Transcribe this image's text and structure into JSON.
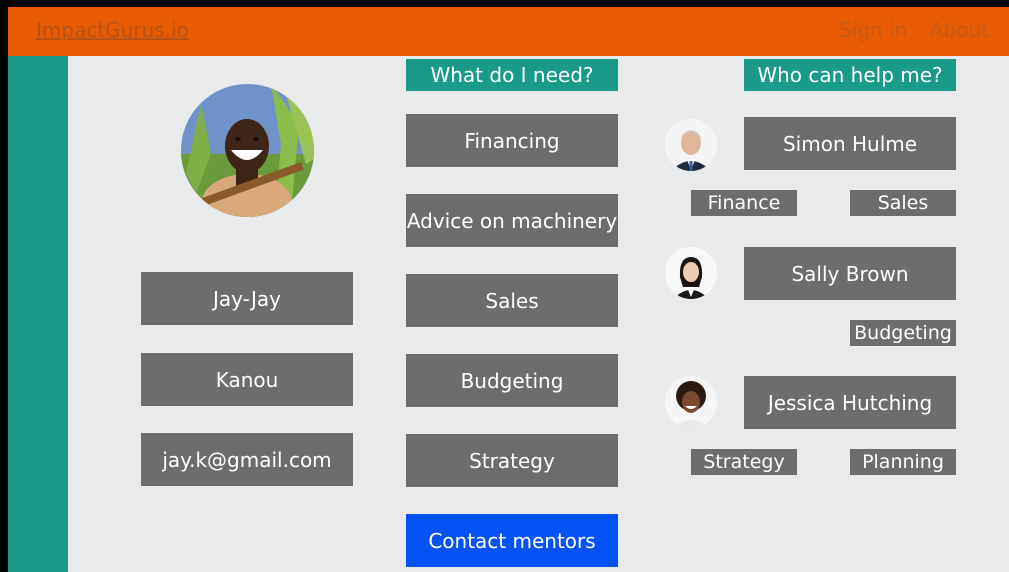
{
  "header": {
    "brand": "ImpactGurus.io",
    "nav": [
      "Sign in",
      "About"
    ]
  },
  "profile": {
    "fields": [
      "Jay-Jay",
      "Kanou",
      "jay.k@gmail.com"
    ]
  },
  "needs": {
    "title": "What do I need?",
    "items": [
      "Financing",
      "Advice on machinery",
      "Sales",
      "Budgeting",
      "Strategy"
    ],
    "action": "Contact mentors"
  },
  "mentors": {
    "title": "Who can help me?",
    "people": [
      {
        "name": "Simon Hulme",
        "tags": [
          "Finance",
          "Sales"
        ]
      },
      {
        "name": "Sally Brown",
        "tags": [
          "Budgeting"
        ]
      },
      {
        "name": "Jessica Hutching",
        "tags": [
          "Strategy",
          "Planning"
        ]
      }
    ]
  },
  "colors": {
    "topbar": "#e95c04",
    "sidebar": "#1a9b89",
    "box": "#6d6d6d",
    "header_box": "#1a9b89",
    "contact_button": "#0653f5",
    "background": "#e8eaeb"
  }
}
